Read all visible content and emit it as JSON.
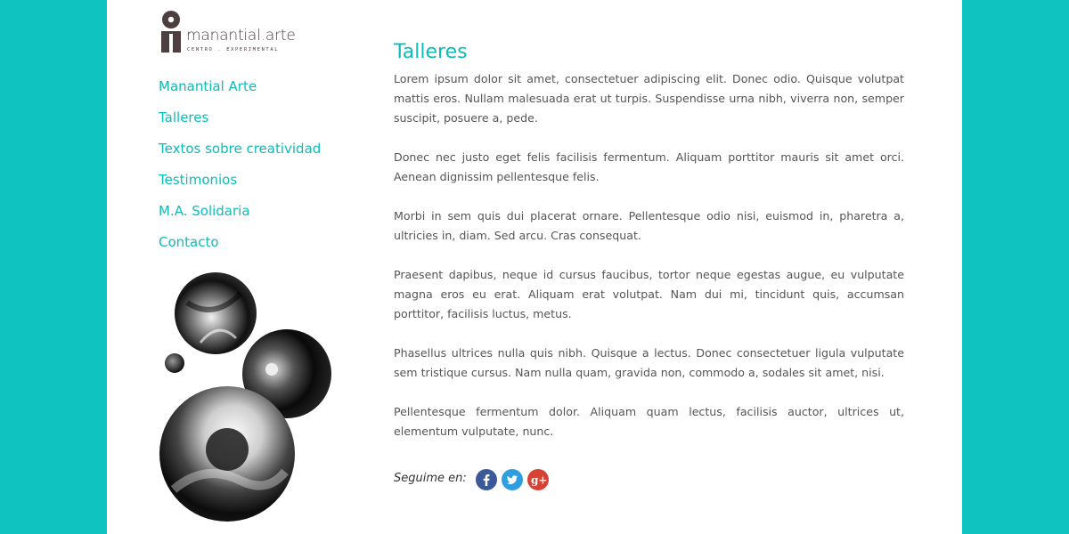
{
  "brand": {
    "name_part1": "manantial",
    "name_dot": ".",
    "name_part2": "arte",
    "tagline": "CENTRO . EXPERIMENTAL"
  },
  "nav": {
    "items": [
      {
        "label": "Manantial Arte"
      },
      {
        "label": "Talleres"
      },
      {
        "label": "Textos sobre creatividad"
      },
      {
        "label": "Testimonios"
      },
      {
        "label": "M.A. Solidaria"
      },
      {
        "label": "Contacto"
      }
    ]
  },
  "main": {
    "title": "Talleres",
    "paragraphs": [
      "Lorem ipsum dolor sit amet, consectetuer adipiscing elit. Donec odio. Quisque volutpat mattis eros. Nullam malesuada erat ut turpis. Suspendisse urna nibh, viverra non, semper suscipit, posuere a, pede.",
      "Donec nec justo eget felis facilisis fermentum. Aliquam porttitor mauris sit amet orci. Aenean dignissim pellentesque felis.",
      "Morbi in sem quis dui placerat ornare. Pellentesque odio nisi, euismod in, pharetra a, ultricies in, diam. Sed arcu. Cras consequat.",
      "Praesent dapibus, neque id cursus faucibus, tortor neque egestas augue, eu vulputate magna eros eu erat. Aliquam erat volutpat. Nam dui mi, tincidunt quis, accumsan porttitor, facilisis luctus, metus.",
      "Phasellus ultrices nulla quis nibh. Quisque a lectus. Donec consectetuer ligula vulputate sem tristique cursus. Nam nulla quam, gravida non, commodo a, sodales sit amet, nisi.",
      "Pellentesque fermentum dolor. Aliquam quam lectus, facilisis auctor, ultrices ut, elementum vulputate, nunc."
    ]
  },
  "social": {
    "label": "Seguime en:",
    "icons": [
      {
        "name": "facebook-icon",
        "glyph": "f",
        "color": "#3b5998"
      },
      {
        "name": "twitter-icon",
        "glyph": "",
        "color": "#2f9ee0"
      },
      {
        "name": "google-plus-icon",
        "glyph": "g+",
        "color": "#d64233"
      }
    ]
  },
  "colors": {
    "background": "#0fc4c0",
    "accent": "#0fbcb8",
    "page": "#ffffff",
    "text": "#555555",
    "logo": "#4d3f3f"
  }
}
